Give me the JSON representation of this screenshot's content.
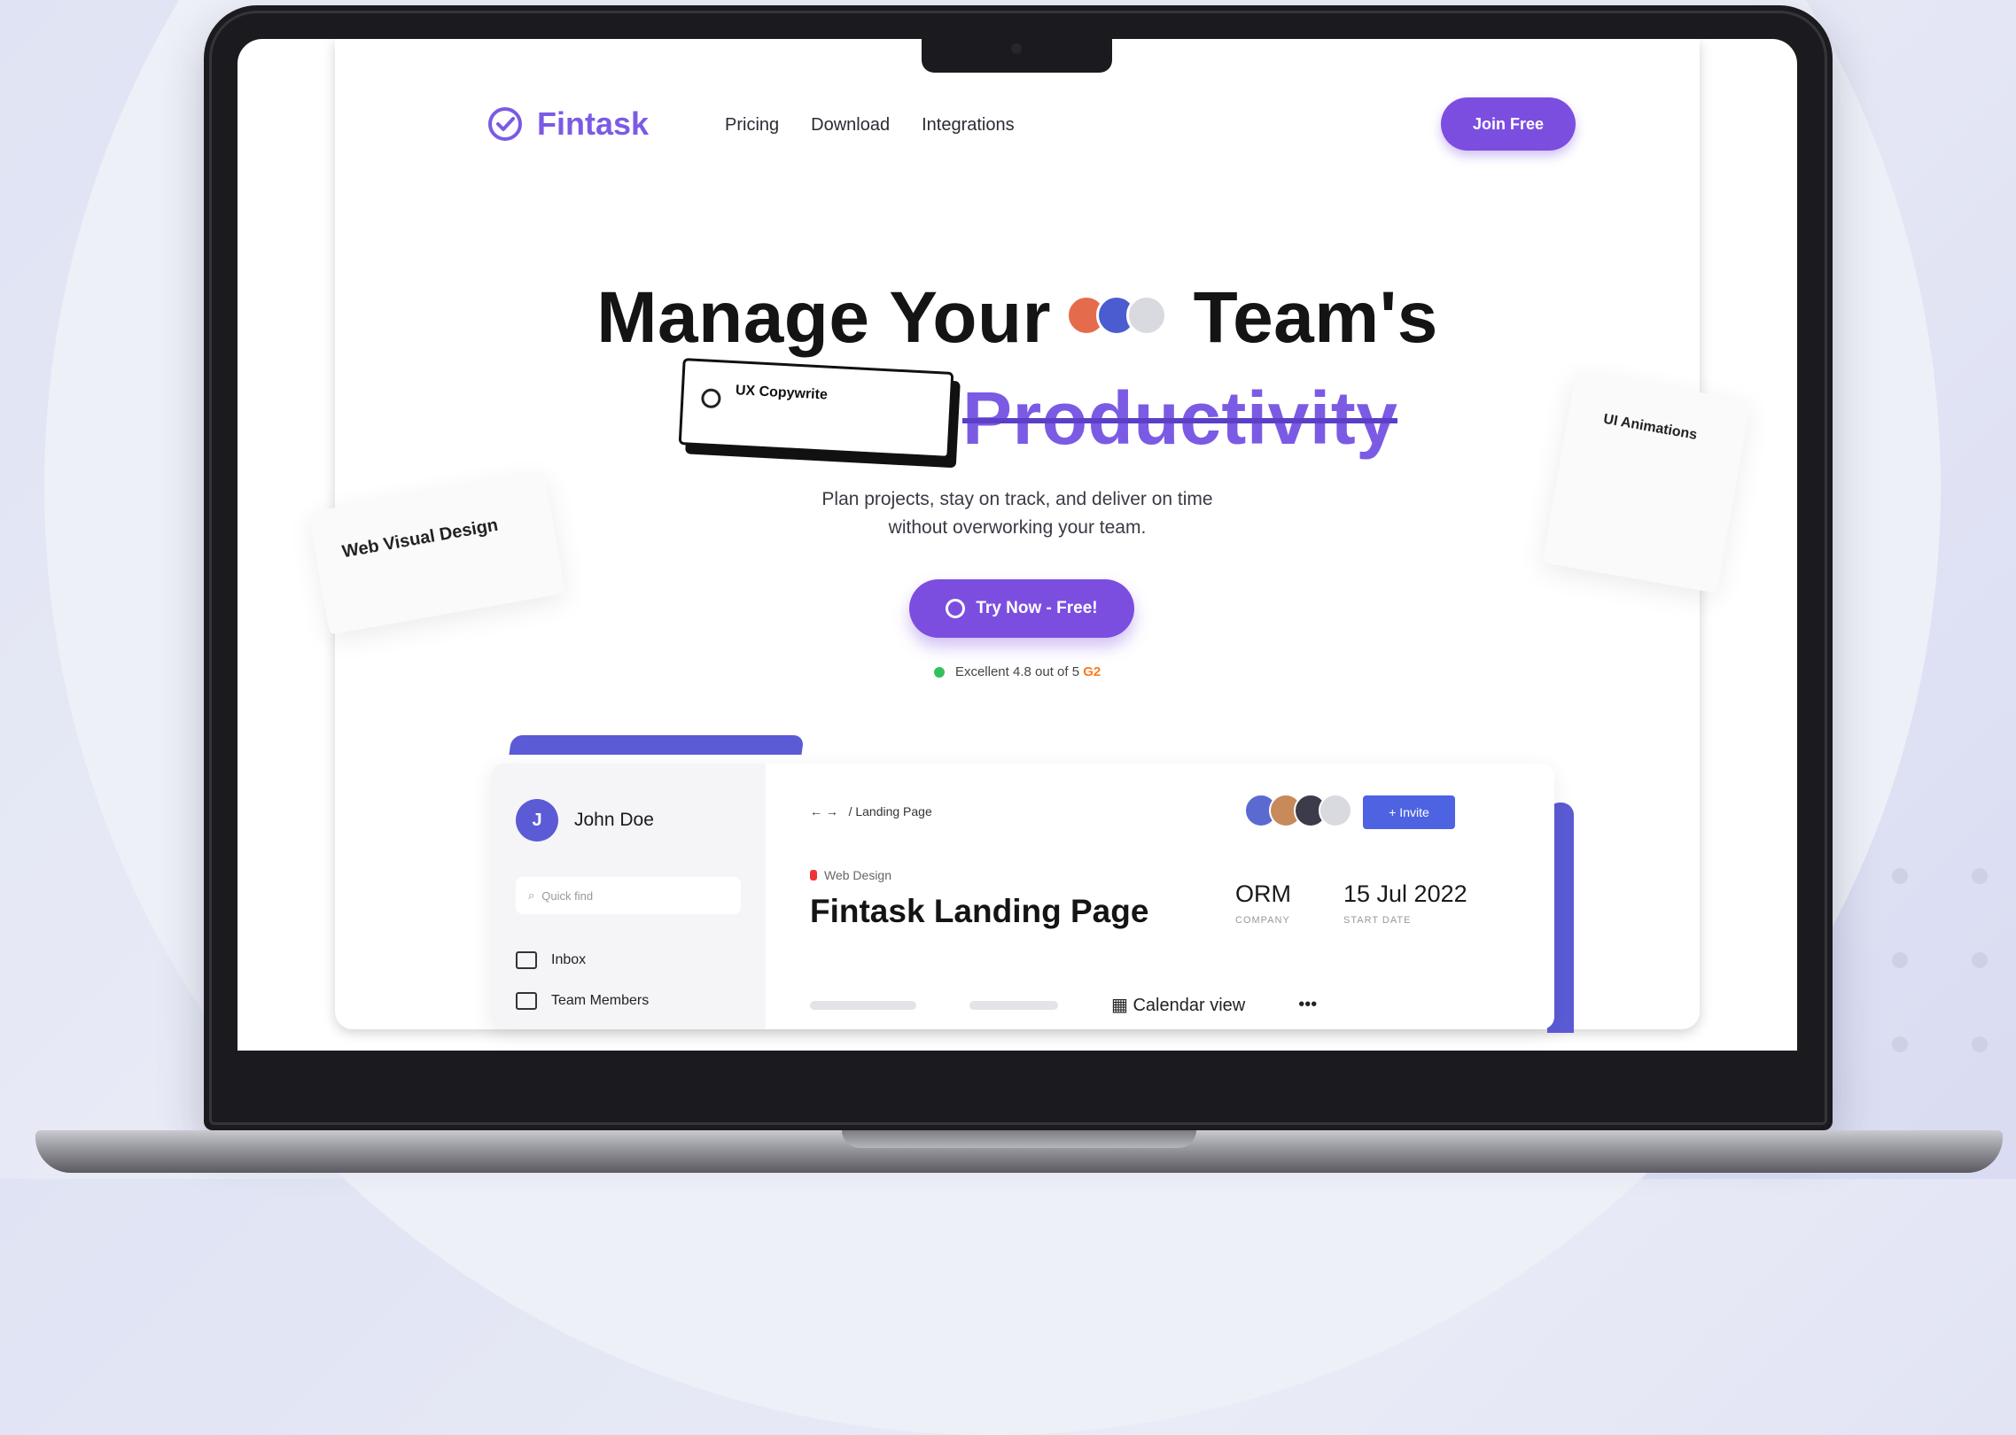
{
  "nav": {
    "brand": "Fintask",
    "links": [
      "Pricing",
      "Download",
      "Integrations"
    ],
    "cta": "Join Free"
  },
  "hero": {
    "line1_a": "Manage Your",
    "line1_b": "Team's",
    "line2": "Productivity",
    "subtitle_line1": "Plan projects, stay on track, and deliver on time",
    "subtitle_line2": "without overworking your team.",
    "cta": "Try Now - Free!",
    "rating_prefix": "Excellent",
    "rating_value": "4.8 out of 5",
    "rating_brand": "G2"
  },
  "floating_cards": {
    "ux": {
      "title": "UX Copywrite"
    },
    "left": {
      "title": "Web Visual Design"
    },
    "right": {
      "title": "UI Animations"
    }
  },
  "dashboard": {
    "user": {
      "initial": "J",
      "name": "John Doe"
    },
    "quickfind_placeholder": "Quick find",
    "side_items": [
      "Inbox",
      "Team Members"
    ],
    "breadcrumb": "/ Landing Page",
    "invite": "+ Invite",
    "tag": "Web Design",
    "project_title": "Fintask Landing Page",
    "company": {
      "value": "ORM",
      "label": "COMPANY"
    },
    "start_date": {
      "value": "15 Jul 2022",
      "label": "START DATE"
    },
    "calendar_view": "Calendar view",
    "more": "•••"
  },
  "colors": {
    "brand": "#7b5be4",
    "button": "#7b4ee0",
    "accent_blue": "#5b5bd6",
    "rating_green": "#33c15a"
  }
}
